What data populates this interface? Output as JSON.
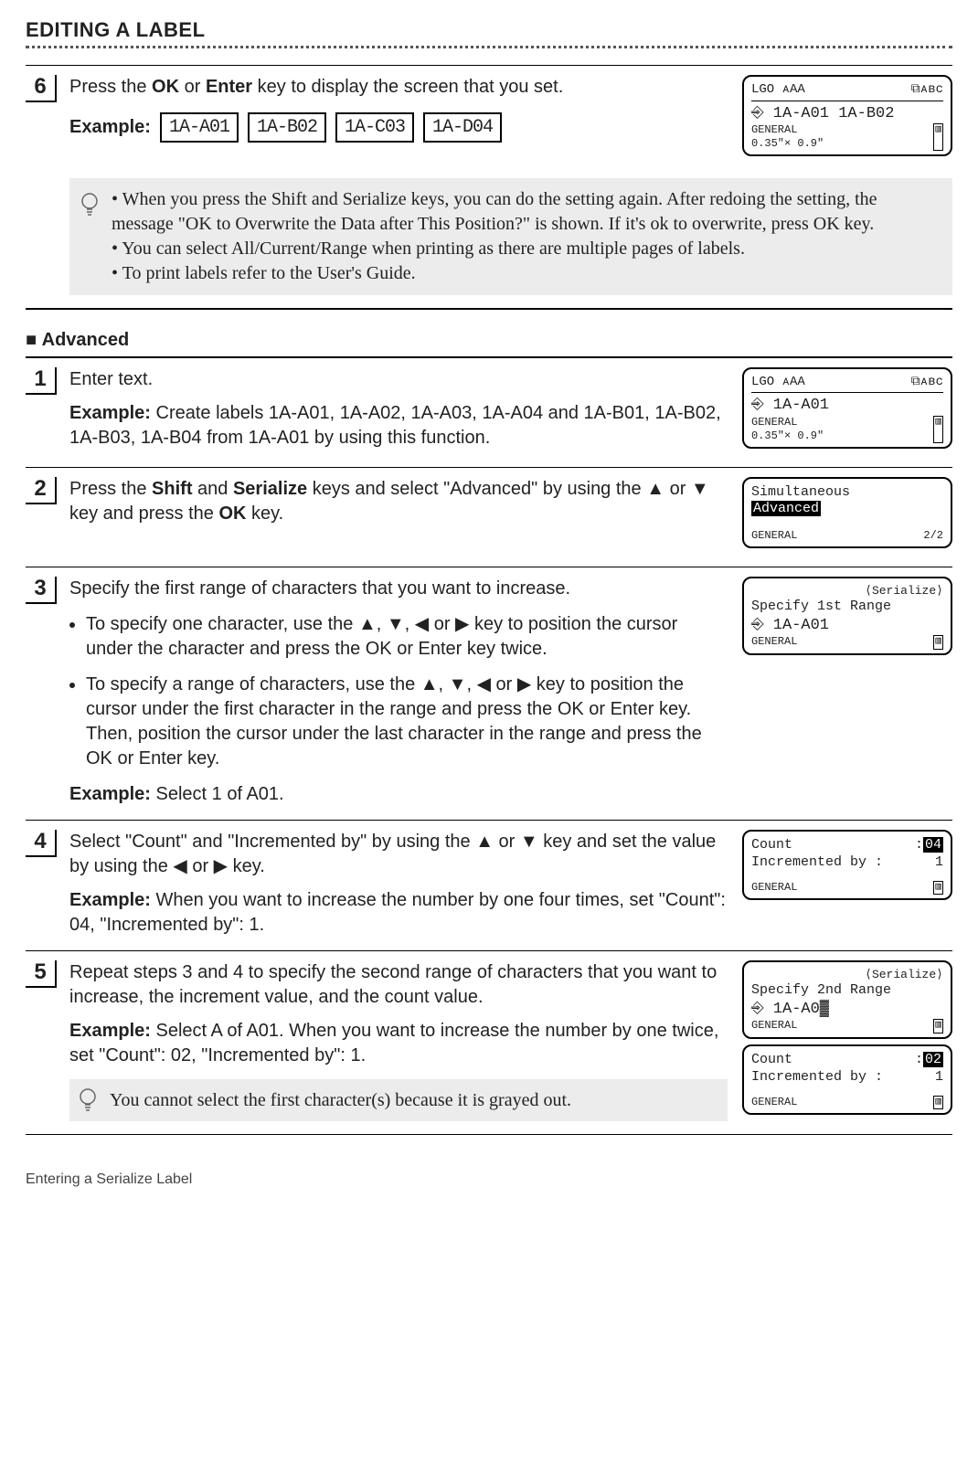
{
  "header": "EDITING A LABEL",
  "steps_upper": [
    {
      "num": "6",
      "text_pre": "Press the ",
      "bold1": "OK",
      "mid1": " or ",
      "bold2": "Enter",
      "text_post": " key to display the screen that you set.",
      "example_label": "Example:",
      "chips": [
        "1A-A01",
        "1A-B02",
        "1A-C03",
        "1A-D04"
      ],
      "tips": [
        "When you press the Shift and Serialize keys, you can do the setting again. After redoing the setting, the message \"OK to Overwrite the Data after This Position?\" is shown. If it's ok to overwrite, press OK key.",
        "You can select All/Current/Range when printing as there are multiple pages of labels.",
        "To print labels refer to the User's Guide."
      ],
      "lcd": {
        "top_left": "LGO ᴀAA",
        "top_right": "⧉ᴀʙᴄ",
        "mid": "⎆ 1A-A01 1A-B02",
        "bot_left": "GENERAL",
        "bot_mid": "0.35\"× 0.9\"",
        "bot_right": "▥"
      }
    }
  ],
  "advanced_header": "Advanced",
  "adv": [
    {
      "num": "1",
      "text": "Enter text.",
      "example_label": "Example:",
      "example_text": " Create labels 1A-A01, 1A-A02, 1A-A03, 1A-A04 and 1A-B01, 1A-B02, 1A-B03, 1A-B04 from 1A-A01 by using this function.",
      "lcd": {
        "top_left": "LGO ᴀAA",
        "top_right": "⧉ᴀʙᴄ",
        "mid": "⎆ 1A-A01",
        "bot_left": "GENERAL",
        "bot_mid": "0.35\"× 0.9\"",
        "bot_right": "▥"
      }
    },
    {
      "num": "2",
      "text_parts": [
        "Press the ",
        "Shift",
        " and ",
        "Serialize",
        " keys and select \"Advanced\" by using the ▲ or ▼ key and press the ",
        "OK",
        " key."
      ],
      "lcd": {
        "line1": "Simultaneous",
        "line2_hilite": "Advanced",
        "bot_left": "GENERAL",
        "bot_right": "2/2"
      }
    },
    {
      "num": "3",
      "text": "Specify the first range of characters that you want to increase.",
      "bullets": [
        "To specify one character, use the ▲, ▼, ◀ or ▶ key to position the cursor under the character and press the OK or Enter key twice.",
        "To specify a range of characters, use the ▲, ▼, ◀ or ▶ key to position the cursor under the first character in the range and press the OK or Enter key. Then, position the cursor under the last character in the range and press the OK or Enter key."
      ],
      "example_label": "Example:",
      "example_text": " Select 1 of A01.",
      "lcd": {
        "top_right": "⟨Serialize⟩",
        "line1": "Specify 1st Range",
        "mid": "⎆ 1A-A01",
        "bot_left": "GENERAL",
        "bot_right": "▥"
      }
    },
    {
      "num": "4",
      "text_parts": [
        "Select \"Count\" and \"Incremented by\" by using the ▲ or ▼ key and set the value by using the ◀ or ▶ key."
      ],
      "example_label": "Example:",
      "example_text": " When you want to increase the number by one four times, set \"Count\": 04, \"Incremented by\": 1.",
      "lcd": {
        "line1_left": "Count",
        "line1_right_hilite": "04",
        "line2_left": "Incremented by :",
        "line2_right": "1",
        "bot_left": "GENERAL",
        "bot_right": "▥"
      }
    },
    {
      "num": "5",
      "text": "Repeat steps 3 and 4 to specify the second range of characters that you want to increase, the increment value, and the count value.",
      "example_label": "Example:",
      "example_text": " Select A of A01. When you want to increase the number by one twice, set \"Count\": 02, \"Incremented by\": 1.",
      "tip": "You cannot select the first character(s) because it is grayed out.",
      "lcd_a": {
        "top_right": "⟨Serialize⟩",
        "line1": "Specify 2nd Range",
        "mid": "⎆ 1A-A0▓",
        "bot_left": "GENERAL",
        "bot_right": "▥"
      },
      "lcd_b": {
        "line1_left": "Count",
        "line1_right_hilite": "02",
        "line2_left": "Incremented by :",
        "line2_right": "1",
        "bot_left": "GENERAL",
        "bot_right": "▥"
      }
    }
  ],
  "footer": "Entering a Serialize Label"
}
